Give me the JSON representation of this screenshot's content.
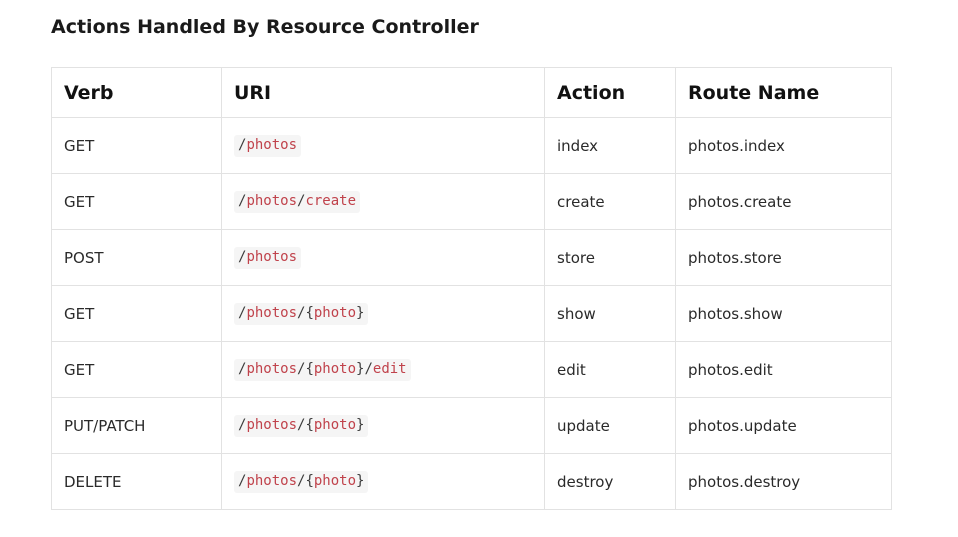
{
  "page": {
    "title": "Actions Handled By Resource Controller"
  },
  "table": {
    "headers": {
      "verb": "Verb",
      "uri": "URI",
      "action": "Action",
      "route_name": "Route Name"
    },
    "rows": [
      {
        "verb": "GET",
        "uri_parts": [
          {
            "text": "/",
            "highlight": false
          },
          {
            "text": "photos",
            "highlight": true
          }
        ],
        "action": "index",
        "route_name": "photos.index"
      },
      {
        "verb": "GET",
        "uri_parts": [
          {
            "text": "/",
            "highlight": false
          },
          {
            "text": "photos",
            "highlight": true
          },
          {
            "text": "/",
            "highlight": false
          },
          {
            "text": "create",
            "highlight": true
          }
        ],
        "action": "create",
        "route_name": "photos.create"
      },
      {
        "verb": "POST",
        "uri_parts": [
          {
            "text": "/",
            "highlight": false
          },
          {
            "text": "photos",
            "highlight": true
          }
        ],
        "action": "store",
        "route_name": "photos.store"
      },
      {
        "verb": "GET",
        "uri_parts": [
          {
            "text": "/",
            "highlight": false
          },
          {
            "text": "photos",
            "highlight": true
          },
          {
            "text": "/{",
            "highlight": false
          },
          {
            "text": "photo",
            "highlight": true
          },
          {
            "text": "}",
            "highlight": false
          }
        ],
        "action": "show",
        "route_name": "photos.show"
      },
      {
        "verb": "GET",
        "uri_parts": [
          {
            "text": "/",
            "highlight": false
          },
          {
            "text": "photos",
            "highlight": true
          },
          {
            "text": "/{",
            "highlight": false
          },
          {
            "text": "photo",
            "highlight": true
          },
          {
            "text": "}/",
            "highlight": false
          },
          {
            "text": "edit",
            "highlight": true
          }
        ],
        "action": "edit",
        "route_name": "photos.edit"
      },
      {
        "verb": "PUT/PATCH",
        "uri_parts": [
          {
            "text": "/",
            "highlight": false
          },
          {
            "text": "photos",
            "highlight": true
          },
          {
            "text": "/{",
            "highlight": false
          },
          {
            "text": "photo",
            "highlight": true
          },
          {
            "text": "}",
            "highlight": false
          }
        ],
        "action": "update",
        "route_name": "photos.update"
      },
      {
        "verb": "DELETE",
        "uri_parts": [
          {
            "text": "/",
            "highlight": false
          },
          {
            "text": "photos",
            "highlight": true
          },
          {
            "text": "/{",
            "highlight": false
          },
          {
            "text": "photo",
            "highlight": true
          },
          {
            "text": "}",
            "highlight": false
          }
        ],
        "action": "destroy",
        "route_name": "photos.destroy"
      }
    ]
  },
  "colors": {
    "code_highlight": "#c0424b",
    "code_background": "#f5f5f5",
    "border": "#e2e2e2"
  }
}
